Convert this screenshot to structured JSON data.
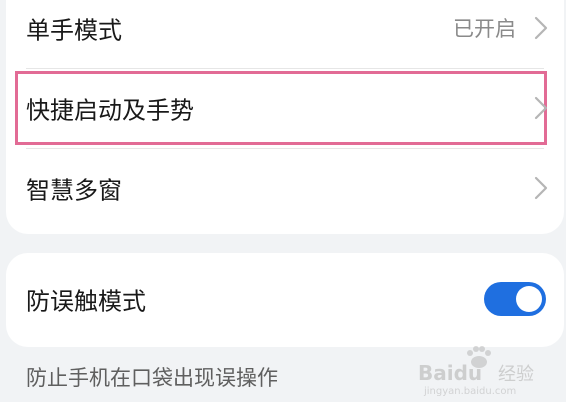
{
  "settings_group_1": {
    "items": [
      {
        "label": "单手模式",
        "value": "已开启"
      },
      {
        "label": "快捷启动及手势"
      },
      {
        "label": "智慧多窗"
      }
    ]
  },
  "settings_group_2": {
    "toggle_item": {
      "label": "防误触模式",
      "toggle_state": "on"
    },
    "description": "防止手机在口袋出现误操作"
  },
  "watermark": {
    "brand": "Baidu",
    "text": "经验",
    "sub": "jingyan.baidu.com"
  },
  "colors": {
    "highlight_border": "#e26b95",
    "toggle_on": "#1f6fe0",
    "background": "#f1f3f5",
    "card": "#ffffff"
  },
  "icons": [
    "chevron-right-icon",
    "toggle-switch"
  ]
}
